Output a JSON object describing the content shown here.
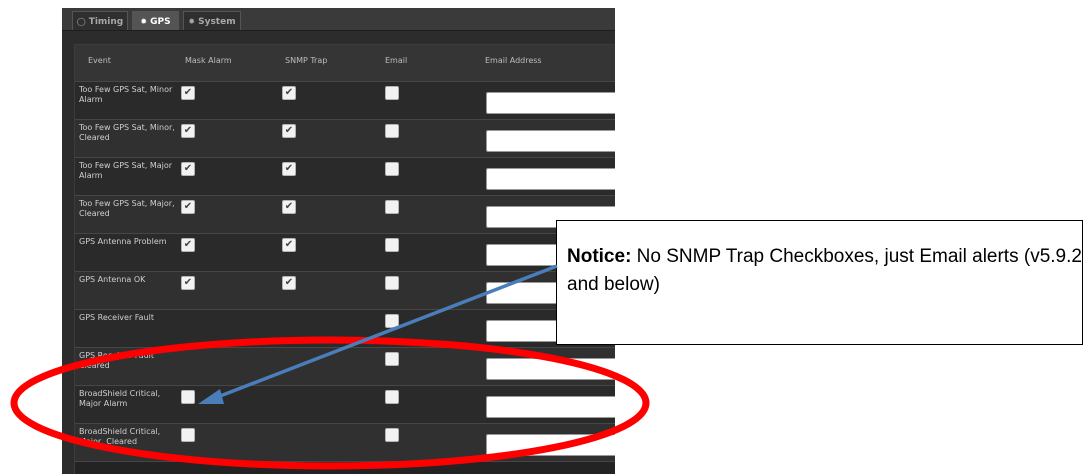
{
  "tabs": [
    {
      "label": "Timing",
      "icon": "clock-icon"
    },
    {
      "label": "GPS",
      "icon": "gear-icon",
      "active": true
    },
    {
      "label": "System",
      "icon": "gear-icon"
    }
  ],
  "table": {
    "headers": [
      "Event",
      "Mask Alarm",
      "SNMP Trap",
      "Email",
      "Email Address"
    ],
    "rows": [
      {
        "event": "Too Few GPS Sat, Minor Alarm",
        "mask_alarm": true,
        "snmp_trap": true,
        "email": false
      },
      {
        "event": "Too Few GPS Sat, Minor, Cleared",
        "mask_alarm": true,
        "snmp_trap": true,
        "email": false
      },
      {
        "event": "Too Few GPS Sat, Major Alarm",
        "mask_alarm": true,
        "snmp_trap": true,
        "email": false
      },
      {
        "event": "Too Few GPS Sat, Major, Cleared",
        "mask_alarm": true,
        "snmp_trap": true,
        "email": false
      },
      {
        "event": "GPS Antenna Problem",
        "mask_alarm": true,
        "snmp_trap": true,
        "email": false
      },
      {
        "event": "GPS Antenna OK",
        "mask_alarm": true,
        "snmp_trap": true,
        "email": false
      },
      {
        "event": "GPS Receiver Fault",
        "mask_alarm": null,
        "snmp_trap": null,
        "email": false
      },
      {
        "event": "GPS Receiver Fault Cleared",
        "mask_alarm": null,
        "snmp_trap": null,
        "email": false
      },
      {
        "event": "BroadShield Critical, Major Alarm",
        "mask_alarm": false,
        "snmp_trap": null,
        "email": false
      },
      {
        "event": "BroadShield Critical, Major, Cleared",
        "mask_alarm": false,
        "snmp_trap": null,
        "email": false
      }
    ]
  },
  "notice": {
    "bold": "Notice:",
    "text": " No SNMP Trap Checkboxes, just Email alerts (v5.9.2 and below)"
  },
  "colors": {
    "arrow": "#4a7ebb",
    "ellipse": "#ff0000"
  }
}
